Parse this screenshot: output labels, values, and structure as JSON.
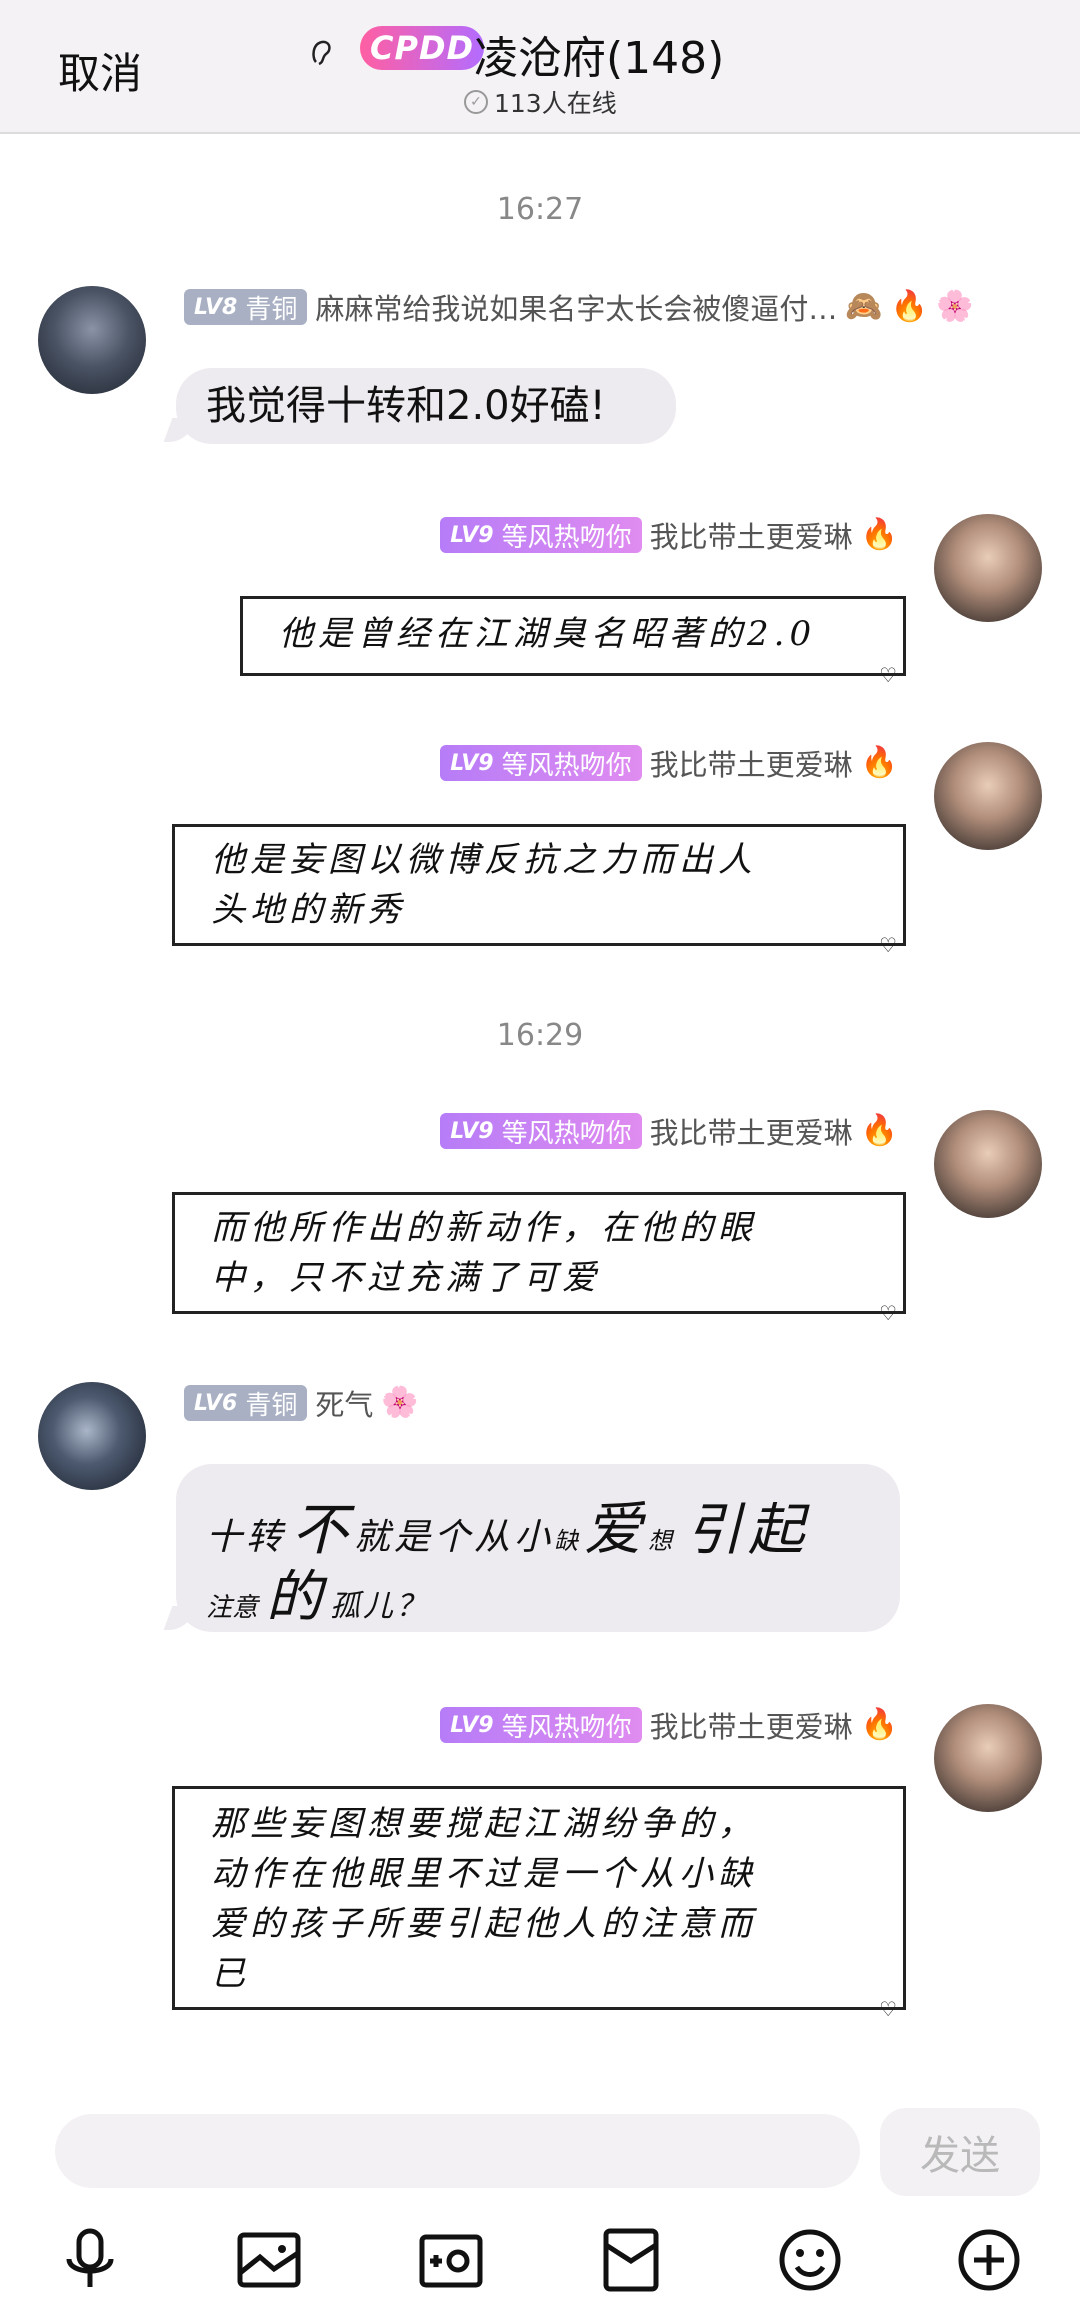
{
  "header": {
    "cancel_label": "取消",
    "brand_logo": "CPDD",
    "title": "凌沧府(148)",
    "online": "113人在线"
  },
  "timestamps": [
    "16:27",
    "16:29"
  ],
  "messages": [
    {
      "level": "LV8",
      "rank": "青铜",
      "nickname": "麻麻常给我说如果名字太长会被傻逼付…",
      "text": "我觉得十转和2.0好磕!"
    },
    {
      "level": "LV9",
      "rank": "等风热吻你",
      "nickname": "我比带土更爱琳",
      "lines": [
        "他是曾经在江湖臭名昭著的2.0"
      ]
    },
    {
      "level": "LV9",
      "rank": "等风热吻你",
      "nickname": "我比带土更爱琳",
      "lines": [
        "他是妄图以微博反抗之力而出人",
        "头地的新秀"
      ]
    },
    {
      "level": "LV9",
      "rank": "等风热吻你",
      "nickname": "我比带土更爱琳",
      "lines": [
        "而他所作出的新动作，在他的眼",
        "中，只不过充满了可爱"
      ]
    },
    {
      "level": "LV6",
      "rank": "青铜",
      "nickname": "死气",
      "line1": [
        "十转",
        "不",
        "就是个从小",
        "缺",
        "爱",
        "想",
        "引起"
      ],
      "line2": [
        "注意",
        "的",
        "孤儿？"
      ]
    },
    {
      "level": "LV9",
      "rank": "等风热吻你",
      "nickname": "我比带土更爱琳",
      "lines": [
        "那些妄图想要搅起江湖纷争的，",
        "动作在他眼里不过是一个从小缺",
        "爱的孩子所要引起他人的注意而",
        "已"
      ]
    }
  ],
  "input": {
    "placeholder": "",
    "send_label": "发送"
  },
  "toolbar": [
    "mic-icon",
    "image-icon",
    "camera-icon",
    "red-packet-icon",
    "emoji-icon",
    "plus-icon"
  ],
  "colors": {
    "header_bg": "#f4f2f5",
    "bubble_gray": "#eeebf0",
    "level_bronze": "#a9b0c3",
    "level_purple": "#b67cf7",
    "send_text": "#b9b9b9"
  }
}
